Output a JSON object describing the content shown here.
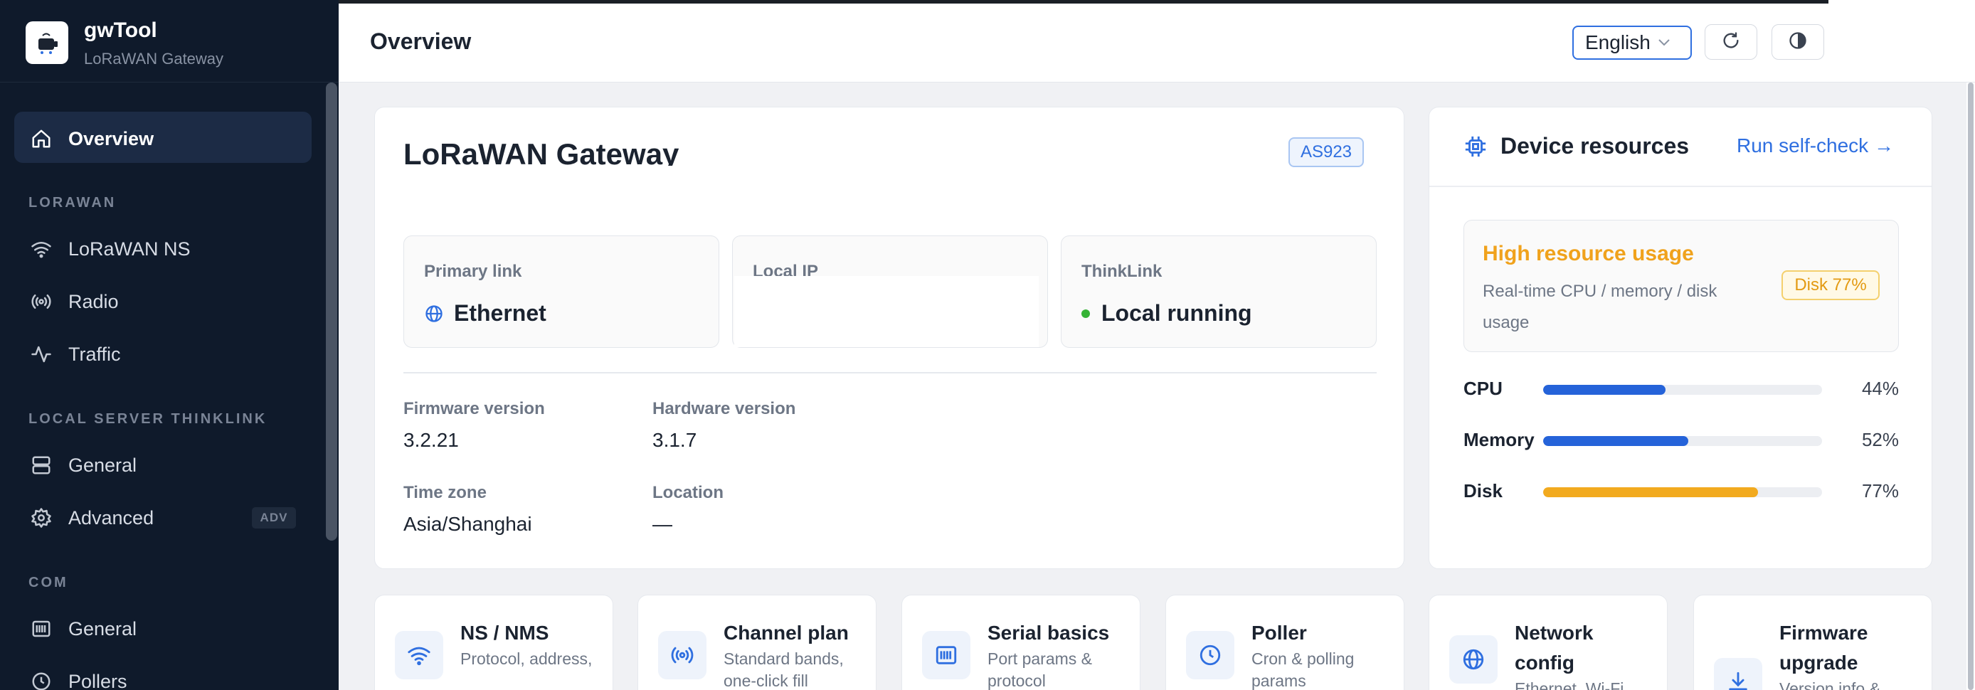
{
  "brand": {
    "name": "gwTool",
    "subtitle": "LoRaWAN Gateway"
  },
  "sidebar": {
    "items": [
      {
        "label": "Overview",
        "icon": "home-icon",
        "active": true
      },
      {
        "section": "LORAWAN"
      },
      {
        "label": "LoRaWAN NS",
        "icon": "wifi-icon"
      },
      {
        "label": "Radio",
        "icon": "radio-icon"
      },
      {
        "label": "Traffic",
        "icon": "activity-icon"
      },
      {
        "section": "LOCAL SERVER THINKLINK"
      },
      {
        "label": "General",
        "icon": "server-icon"
      },
      {
        "label": "Advanced",
        "icon": "gear-icon",
        "badge": "ADV"
      },
      {
        "section": "COM"
      },
      {
        "label": "General",
        "icon": "serial-icon"
      },
      {
        "label": "Pollers",
        "icon": "clock-icon"
      }
    ]
  },
  "header": {
    "title": "Overview",
    "language": "English"
  },
  "gateway": {
    "title": "LoRaWAN Gateway",
    "region": "AS923",
    "stats": [
      {
        "label": "Primary link",
        "value": "Ethernet",
        "icon": "globe-icon"
      },
      {
        "label": "Local IP",
        "value": ""
      },
      {
        "label": "ThinkLink",
        "value": "Local running",
        "status_color": "#36b336"
      }
    ],
    "details": [
      {
        "label": "Firmware version",
        "value": "3.2.21"
      },
      {
        "label": "Hardware version",
        "value": "3.1.7"
      },
      {
        "label": "Time zone",
        "value": "Asia/Shanghai"
      },
      {
        "label": "Location",
        "value": "—"
      }
    ]
  },
  "resources": {
    "title": "Device resources",
    "link": "Run self-check →",
    "alert": {
      "title": "High resource usage",
      "description": "Real-time CPU / memory / disk usage",
      "badge": "Disk 77%"
    },
    "metrics": [
      {
        "label": "CPU",
        "value": 44,
        "display": "44%",
        "color": "#2563d9"
      },
      {
        "label": "Memory",
        "value": 52,
        "display": "52%",
        "color": "#2563d9"
      },
      {
        "label": "Disk",
        "value": 77,
        "display": "77%",
        "color": "#f2aa1f"
      }
    ]
  },
  "tiles": [
    {
      "title": "NS / NMS",
      "description": "Protocol, address,",
      "icon": "wifi-icon"
    },
    {
      "title": "Channel plan",
      "description": "Standard bands, one-click fill",
      "icon": "radio-icon"
    },
    {
      "title": "Serial basics",
      "description": "Port params & protocol",
      "icon": "serial-icon"
    },
    {
      "title": "Poller",
      "description": "Cron & polling params",
      "icon": "clock-icon"
    },
    {
      "title": "Network config",
      "description": "Ethernet, Wi-Fi",
      "icon": "globe-icon"
    },
    {
      "title": "Firmware upgrade",
      "description": "Version info &",
      "icon": "download-icon"
    }
  ]
}
